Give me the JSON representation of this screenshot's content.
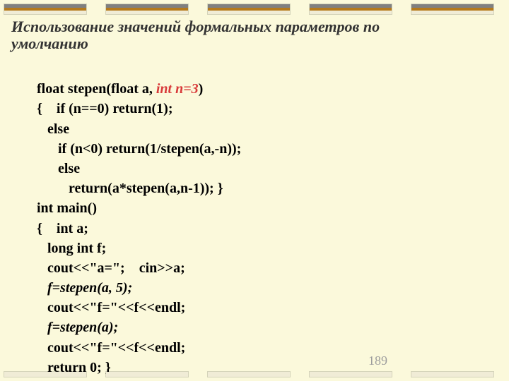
{
  "title": "Использование значений формальных параметров по умолчанию",
  "code": {
    "l1a": "float stepen(float a, ",
    "l1b": "int n=3",
    "l1c": ")",
    "l2": "{    if (n==0) return(1);",
    "l3": "   else",
    "l4": "      if (n<0) return(1/stepen(a,-n));",
    "l5": "      else",
    "l6": "         return(a*stepen(a,n-1)); }",
    "l7": "int main()",
    "l8": "{    int a;",
    "l9": "   long int f;",
    "l10": "   cout<<\"a=\";    cin>>a;",
    "l11": "   f=stepen(a, 5);",
    "l12": "   cout<<\"f=\"<<f<<endl;",
    "l13": "   f=stepen(a);",
    "l14": "   cout<<\"f=\"<<f<<endl;",
    "l15": "   return 0; }"
  },
  "page_number": "189"
}
